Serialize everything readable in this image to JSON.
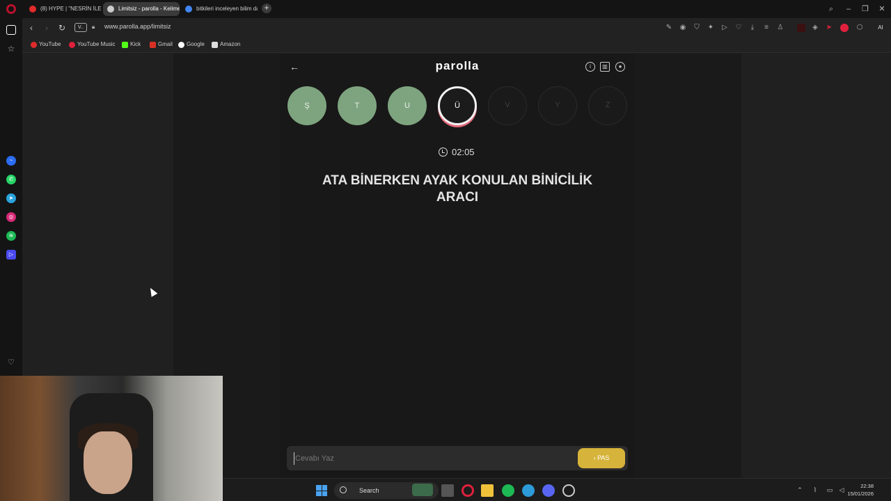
{
  "browser": {
    "tabs": [
      {
        "title": "(8) HYPE | \"NESRİN İLE PA",
        "active": false,
        "favicon_color": "#e02b2b"
      },
      {
        "title": "Limitsiz - parolla - Kelime",
        "active": true,
        "favicon_color": "#cccccc"
      },
      {
        "title": "bitkileri inceleyen bilim da",
        "active": false,
        "favicon_color": "#4285f4"
      }
    ],
    "new_tab_label": "+",
    "url": "www.parolla.app/limitsiz",
    "vpn_label": "V..",
    "bookmarks": [
      {
        "label": "YouTube",
        "color": "#e02b2b"
      },
      {
        "label": "YouTube Music",
        "color": "#e0203c"
      },
      {
        "label": "Kick",
        "color": "#53fc18"
      },
      {
        "label": "Gmail",
        "color": "#d93025"
      },
      {
        "label": "Google",
        "color": "#ffffff"
      },
      {
        "label": "Amazon",
        "color": "#dddddd"
      }
    ],
    "ai_label": "AI"
  },
  "game": {
    "logo": "parolla",
    "letters": [
      {
        "char": "Ş",
        "state": "done"
      },
      {
        "char": "T",
        "state": "done"
      },
      {
        "char": "U",
        "state": "done"
      },
      {
        "char": "Ü",
        "state": "current"
      },
      {
        "char": "V",
        "state": "todo"
      },
      {
        "char": "Y",
        "state": "todo"
      },
      {
        "char": "Z",
        "state": "todo"
      }
    ],
    "timer": "02:05",
    "question": "ATA BİNERKEN AYAK KONULAN BİNİCİLİK ARACI",
    "answer_placeholder": "Cevabı Yaz",
    "pass_label": "PAS",
    "colors": {
      "done": "#7ea47f",
      "current_ring": "#e46a7a",
      "pass_button": "#d6b33a"
    }
  },
  "taskbar": {
    "search_label": "Search",
    "time": "22:38",
    "date": "15/01/2026"
  }
}
